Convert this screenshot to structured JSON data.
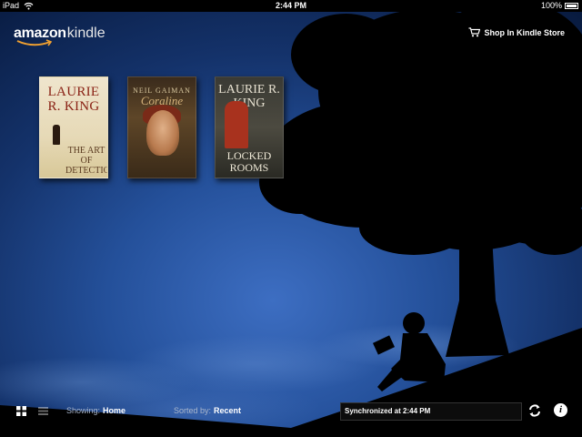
{
  "status_bar": {
    "device": "iPad",
    "time": "2:44 PM",
    "battery": "100%",
    "wifi_icon": "wifi-icon",
    "battery_icon": "battery-icon"
  },
  "header": {
    "logo_amazon": "amazon",
    "logo_kindle": "kindle",
    "store_link": "Shop In Kindle Store",
    "store_icon": "cart-icon"
  },
  "books": [
    {
      "author": "LAURIE R. KING",
      "title": "THE ART OF DETECTION"
    },
    {
      "author": "NEIL GAIMAN",
      "title": "Coraline"
    },
    {
      "author": "LAURIE R. KING",
      "title": "LOCKED ROOMS"
    }
  ],
  "toolbar": {
    "showing_label": "Showing:",
    "showing_value": "Home",
    "sorted_label": "Sorted by:",
    "sorted_value": "Recent",
    "sync_status": "Synchronized at 2:44 PM",
    "grid_icon": "grid-view-icon",
    "list_icon": "list-view-icon",
    "refresh_icon": "refresh-icon",
    "info_icon": "info-icon",
    "info_glyph": "i"
  },
  "colors": {
    "sky_top": "#081a3e",
    "sky_mid": "#24509a",
    "silhouette": "#000000",
    "accent_smile": "#f0a030"
  }
}
